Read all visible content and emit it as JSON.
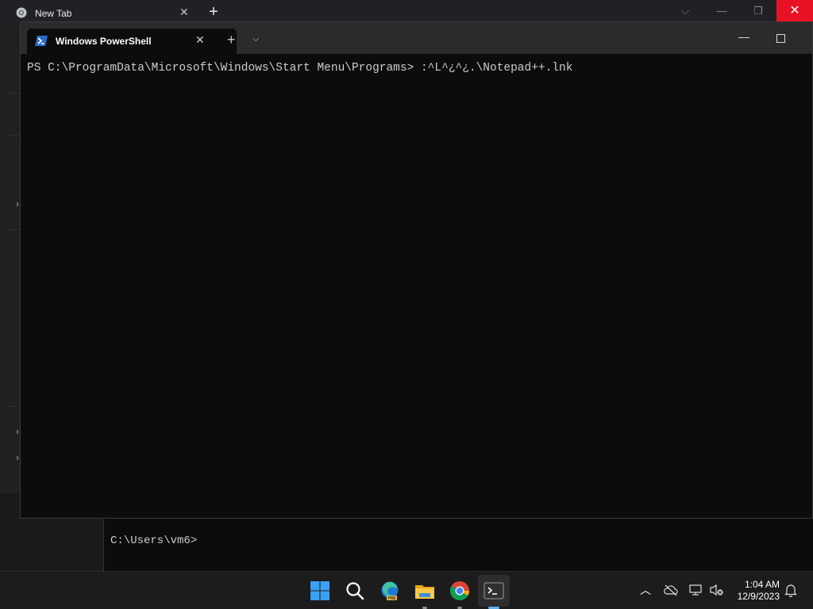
{
  "chrome": {
    "tab_title": "New Tab",
    "tab_close": "✕",
    "new_tab": "+",
    "controls": {
      "dropdown": "⌵",
      "minimize": "—",
      "restore": "❐",
      "close": "✕"
    }
  },
  "terminal": {
    "tab_title": "Windows PowerShell",
    "tab_close": "✕",
    "new_tab": "+",
    "dropdown": "⌵",
    "minimize": "—",
    "output_line": "PS C:\\ProgramData\\Microsoft\\Windows\\Start Menu\\Programs> :^L^¿^¿.\\Notepad++.lnk"
  },
  "cmd_window": {
    "prompt": "C:\\Users\\vm6>"
  },
  "taskbar": {
    "icons": [
      "windows-start-icon",
      "search-icon",
      "edge-beta-icon",
      "file-explorer-icon",
      "chrome-icon",
      "terminal-icon"
    ],
    "tray": {
      "time": "1:04 AM",
      "date": "12/9/2023"
    }
  },
  "colors": {
    "terminal_bg": "#0c0c0c",
    "taskbar_bg": "#1c1c1c",
    "chrome_close": "#e81123"
  }
}
